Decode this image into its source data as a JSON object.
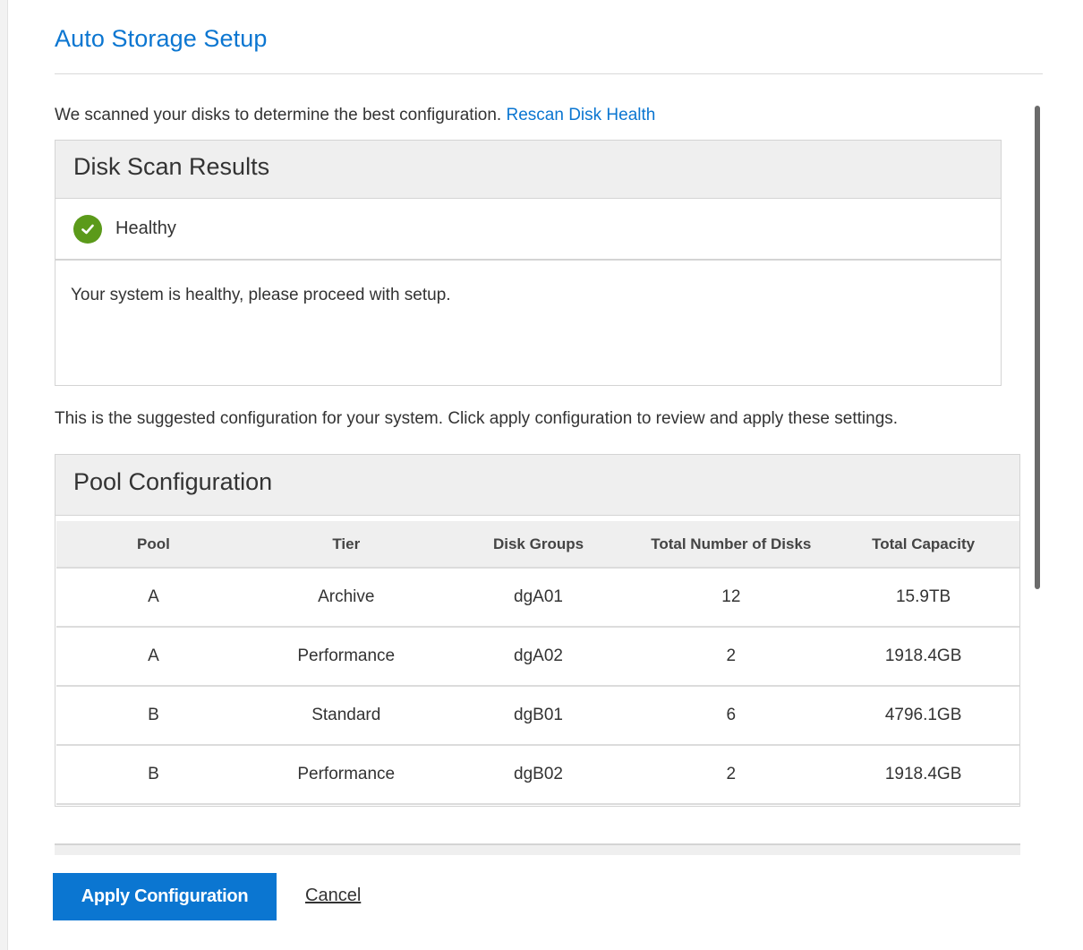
{
  "dialog": {
    "title": "Auto Storage Setup"
  },
  "intro": {
    "text": "We scanned your disks to determine the best configuration.",
    "rescan_link": "Rescan Disk Health"
  },
  "scan_results": {
    "heading": "Disk Scan Results",
    "status_icon": "check-circle-icon",
    "status_color": "#5b9a1a",
    "status_label": "Healthy",
    "message": "Your system is healthy, please proceed with setup."
  },
  "suggestion_text": "This is the suggested configuration for your system. Click apply configuration to review and apply these settings.",
  "pool_config": {
    "heading": "Pool Configuration",
    "columns": [
      "Pool",
      "Tier",
      "Disk Groups",
      "Total Number of Disks",
      "Total Capacity"
    ],
    "rows": [
      [
        "A",
        "Archive",
        "dgA01",
        "12",
        "15.9TB"
      ],
      [
        "A",
        "Performance",
        "dgA02",
        "2",
        "1918.4GB"
      ],
      [
        "B",
        "Standard",
        "dgB01",
        "6",
        "4796.1GB"
      ],
      [
        "B",
        "Performance",
        "dgB02",
        "2",
        "1918.4GB"
      ]
    ]
  },
  "actions": {
    "apply_label": "Apply Configuration",
    "cancel_label": "Cancel"
  },
  "colors": {
    "accent": "#0b76d1",
    "header_bg": "#efefef"
  }
}
